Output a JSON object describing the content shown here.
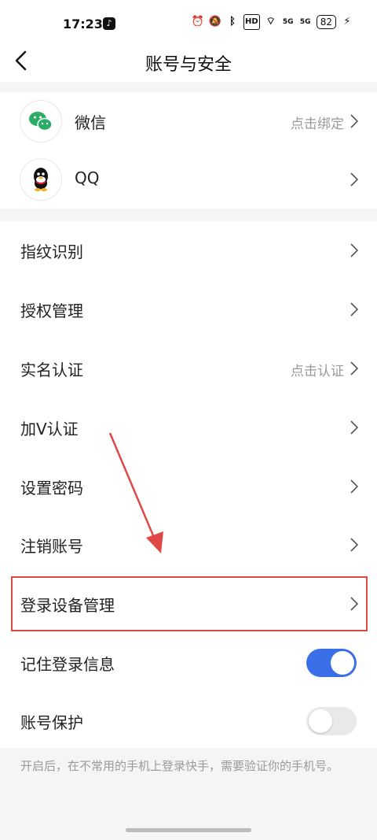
{
  "status_bar": {
    "time": "17:23",
    "battery": "82",
    "hd_label": "HD",
    "signal_1": "5G",
    "signal_2": "5G",
    "icons": [
      "tiktok-icon",
      "alarm-icon",
      "mute-icon",
      "bluetooth-icon",
      "hd-icon",
      "wifi-icon",
      "signal-icon",
      "signal-icon",
      "battery-icon",
      "charging-icon"
    ]
  },
  "header": {
    "title": "账号与安全"
  },
  "social": [
    {
      "label": "微信",
      "value": "点击绑定",
      "icon": "wechat-icon"
    },
    {
      "label": "QQ",
      "value": "",
      "icon": "qq-icon"
    }
  ],
  "settings": [
    {
      "label": "指纹识别",
      "value": ""
    },
    {
      "label": "授权管理",
      "value": ""
    },
    {
      "label": "实名认证",
      "value": "点击认证"
    },
    {
      "label": "加V认证",
      "value": ""
    },
    {
      "label": "设置密码",
      "value": ""
    },
    {
      "label": "注销账号",
      "value": ""
    },
    {
      "label": "登录设备管理",
      "value": ""
    }
  ],
  "toggles": [
    {
      "label": "记住登录信息",
      "on": true
    },
    {
      "label": "账号保护",
      "on": false
    }
  ],
  "footnote": "开启后，在不常用的手机上登录快手，需要验证你的手机号。",
  "colors": {
    "accent": "#3b6fe8",
    "annotation": "#e04848",
    "wechat": "#2aae67"
  }
}
